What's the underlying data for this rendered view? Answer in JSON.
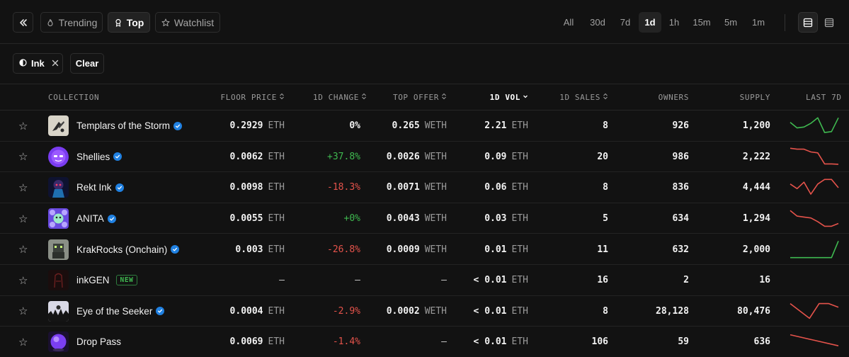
{
  "toolbar": {
    "collapse_icon": "double-chevron-left-icon",
    "tabs": [
      {
        "label": "Trending",
        "icon": "flame-icon"
      },
      {
        "label": "Top",
        "icon": "award-icon"
      },
      {
        "label": "Watchlist",
        "icon": "star-icon"
      }
    ],
    "active_tab": "Top",
    "timeframes": [
      "All",
      "30d",
      "7d",
      "1d",
      "1h",
      "15m",
      "5m",
      "1m"
    ],
    "active_timeframe": "1d",
    "view_icons": [
      "table-view-icon",
      "list-view-icon"
    ]
  },
  "filters": {
    "chip_label": "Ink",
    "chip_icon": "ink-chain-icon",
    "remove_icon": "close-icon",
    "clear_label": "Clear"
  },
  "table": {
    "headers": {
      "collection": "COLLECTION",
      "floor": "FLOOR PRICE",
      "change": "1D CHANGE",
      "offer": "TOP OFFER",
      "vol": "1D VOL",
      "sales": "1D SALES",
      "owners": "OWNERS",
      "supply": "SUPPLY",
      "last": "LAST 7D"
    },
    "sorted_by": "1D VOL",
    "rows": [
      {
        "name": "Templars of the Storm",
        "verified": true,
        "floor": "0.2929",
        "floor_unit": "ETH",
        "change": "0%",
        "change_dir": "flat",
        "offer": "0.265",
        "offer_unit": "WETH",
        "vol": "2.21",
        "vol_unit": "ETH",
        "sales": "8",
        "owners": "926",
        "supply": "1,200",
        "spark_color": "#3fb950",
        "spark": [
          0.3,
          0.6,
          0.55,
          0.35,
          0.05,
          0.85,
          0.8,
          0.05
        ]
      },
      {
        "name": "Shellies",
        "verified": true,
        "floor": "0.0062",
        "floor_unit": "ETH",
        "change": "+37.8%",
        "change_dir": "up",
        "offer": "0.0026",
        "offer_unit": "WETH",
        "vol": "0.09",
        "vol_unit": "ETH",
        "sales": "20",
        "owners": "986",
        "supply": "2,222",
        "spark_color": "#e5534b",
        "spark": [
          0.05,
          0.1,
          0.1,
          0.25,
          0.3,
          0.9,
          0.9,
          0.92
        ]
      },
      {
        "name": "Rekt Ink",
        "verified": true,
        "floor": "0.0098",
        "floor_unit": "ETH",
        "change": "-18.3%",
        "change_dir": "down",
        "offer": "0.0071",
        "offer_unit": "WETH",
        "vol": "0.06",
        "vol_unit": "ETH",
        "sales": "8",
        "owners": "836",
        "supply": "4,444",
        "spark_color": "#e5534b",
        "spark": [
          0.3,
          0.55,
          0.2,
          0.85,
          0.3,
          0.05,
          0.05,
          0.5
        ]
      },
      {
        "name": "ANITA",
        "verified": true,
        "floor": "0.0055",
        "floor_unit": "ETH",
        "change": "+0%",
        "change_dir": "up",
        "offer": "0.0043",
        "offer_unit": "WETH",
        "vol": "0.03",
        "vol_unit": "ETH",
        "sales": "5",
        "owners": "634",
        "supply": "1,294",
        "spark_color": "#e5534b",
        "spark": [
          0.05,
          0.35,
          0.4,
          0.45,
          0.65,
          0.9,
          0.9,
          0.75
        ]
      },
      {
        "name": "KrakRocks (Onchain)",
        "verified": true,
        "floor": "0.003",
        "floor_unit": "ETH",
        "change": "-26.8%",
        "change_dir": "down",
        "offer": "0.0009",
        "offer_unit": "WETH",
        "vol": "0.01",
        "vol_unit": "ETH",
        "sales": "11",
        "owners": "632",
        "supply": "2,000",
        "spark_color": "#3fb950",
        "spark": [
          0.95,
          0.95,
          0.95,
          0.95,
          0.95,
          0.95,
          0.95,
          0.05
        ]
      },
      {
        "name": "inkGEN",
        "verified": false,
        "badge": "NEW",
        "floor": "–",
        "floor_unit": "",
        "change": "–",
        "change_dir": "none",
        "offer": "–",
        "offer_unit": "",
        "vol": "< 0.01",
        "vol_unit": "ETH",
        "sales": "16",
        "owners": "2",
        "supply": "16",
        "spark_color": "",
        "spark": []
      },
      {
        "name": "Eye of the Seeker",
        "verified": true,
        "floor": "0.0004",
        "floor_unit": "ETH",
        "change": "-2.9%",
        "change_dir": "down",
        "offer": "0.0002",
        "offer_unit": "WETH",
        "vol": "< 0.01",
        "vol_unit": "ETH",
        "sales": "8",
        "owners": "28,128",
        "supply": "80,476",
        "spark_color": "#e5534b",
        "spark": [
          0.1,
          0.5,
          0.9,
          0.1,
          0.1,
          0.3
        ]
      },
      {
        "name": "Drop Pass",
        "verified": false,
        "floor": "0.0069",
        "floor_unit": "ETH",
        "change": "-1.4%",
        "change_dir": "down",
        "offer": "–",
        "offer_unit": "",
        "vol": "< 0.01",
        "vol_unit": "ETH",
        "sales": "106",
        "owners": "59",
        "supply": "636",
        "spark_color": "#e5534b",
        "spark": [
          0.1,
          0.4,
          0.7
        ]
      }
    ]
  }
}
